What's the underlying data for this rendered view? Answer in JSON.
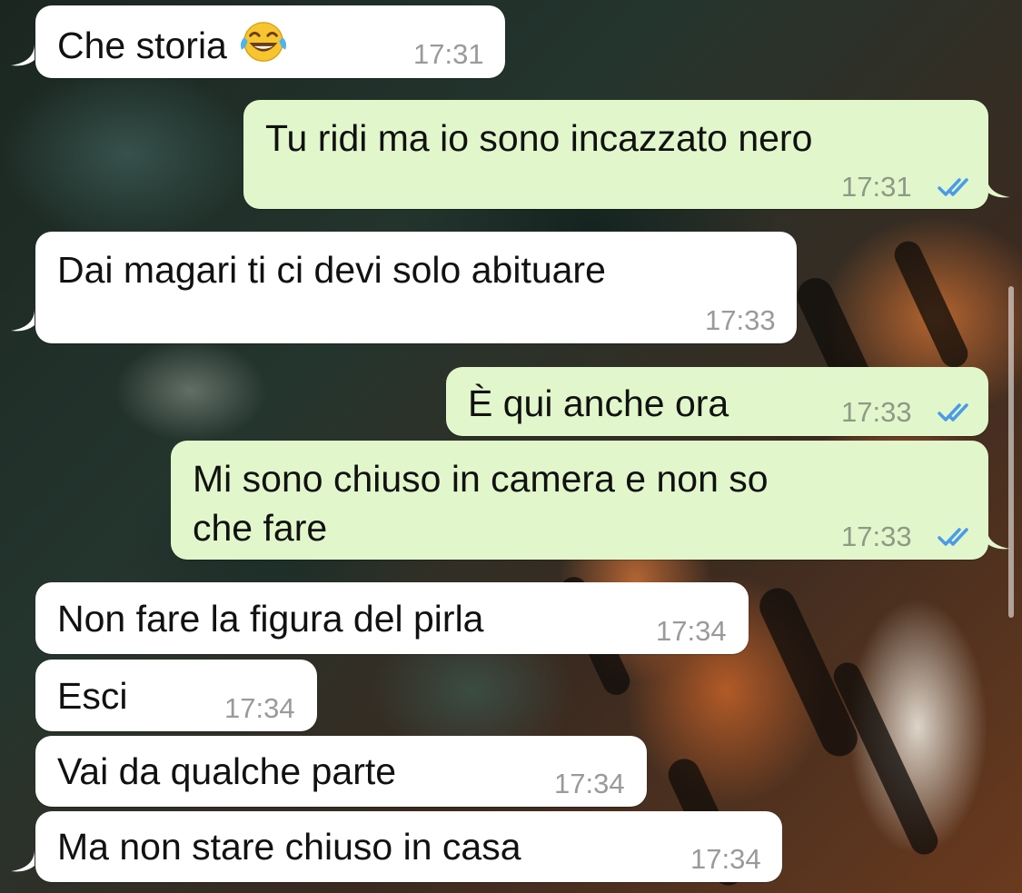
{
  "chat": {
    "messages": [
      {
        "direction": "in",
        "text": "Che storia",
        "emoji": "face-with-tears-of-joy",
        "time": "17:31"
      },
      {
        "direction": "out",
        "text": "Tu ridi ma io sono incazzato nero",
        "time": "17:31",
        "status": "read"
      },
      {
        "direction": "in",
        "text": "Dai magari ti ci devi solo abituare",
        "time": "17:33"
      },
      {
        "direction": "out",
        "text": "È qui anche ora",
        "time": "17:33",
        "status": "read"
      },
      {
        "direction": "out",
        "lines": [
          "Mi sono chiuso in camera e non so",
          "che fare"
        ],
        "time": "17:33",
        "status": "read"
      },
      {
        "direction": "in",
        "text": "Non fare la figura del pirla",
        "time": "17:34"
      },
      {
        "direction": "in",
        "text": "Esci",
        "time": "17:34"
      },
      {
        "direction": "in",
        "text": "Vai da qualche parte",
        "time": "17:34"
      },
      {
        "direction": "in",
        "text": "Ma non stare chiuso in casa",
        "time": "17:34"
      }
    ]
  },
  "colors": {
    "incoming_bubble": "#ffffff",
    "outgoing_bubble": "#e1f7cb",
    "read_ticks": "#4a9be8",
    "timestamp": "#9a9a9a"
  },
  "icons": {
    "read_receipt": "double-check-icon",
    "emoji": "face-with-tears-of-joy-icon"
  }
}
